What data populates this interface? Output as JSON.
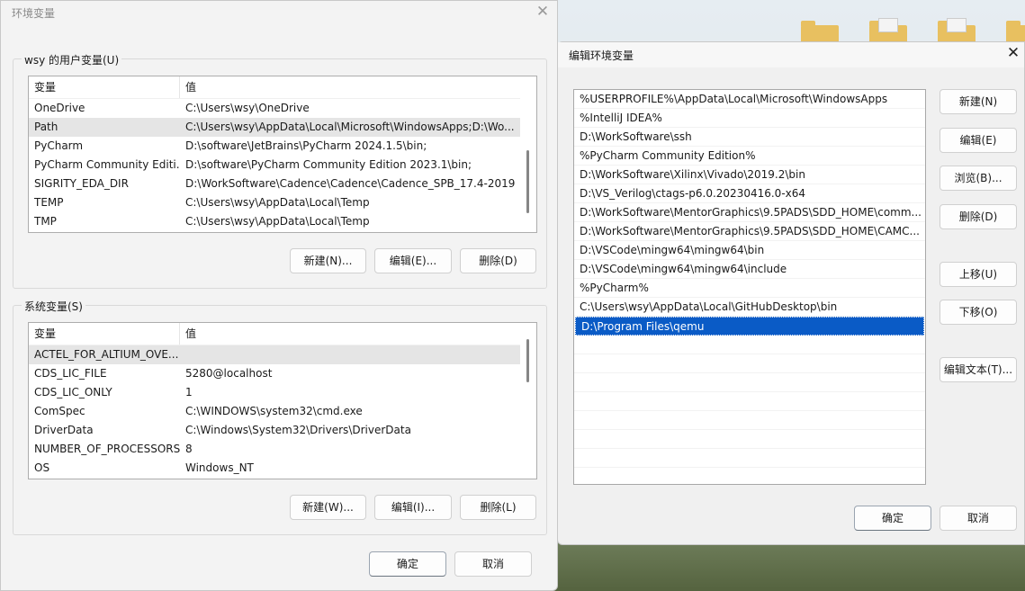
{
  "main_window": {
    "title": "环境变量",
    "user_vars": {
      "group_label": "wsy 的用户变量(U)",
      "col_name": "变量",
      "col_value": "值",
      "rows": [
        {
          "name": "OneDrive",
          "value": "C:\\Users\\wsy\\OneDrive"
        },
        {
          "name": "Path",
          "value": "C:\\Users\\wsy\\AppData\\Local\\Microsoft\\WindowsApps;D:\\Wo..."
        },
        {
          "name": "PyCharm",
          "value": "D:\\software\\JetBrains\\PyCharm 2024.1.5\\bin;"
        },
        {
          "name": "PyCharm Community Editi...",
          "value": "D:\\software\\PyCharm Community Edition 2023.1\\bin;"
        },
        {
          "name": "SIGRITY_EDA_DIR",
          "value": "D:\\WorkSoftware\\Cadence\\Cadence\\Cadence_SPB_17.4-2019"
        },
        {
          "name": "TEMP",
          "value": "C:\\Users\\wsy\\AppData\\Local\\Temp"
        },
        {
          "name": "TMP",
          "value": "C:\\Users\\wsy\\AppData\\Local\\Temp"
        }
      ],
      "new_label": "新建(N)...",
      "edit_label": "编辑(E)...",
      "delete_label": "删除(D)"
    },
    "system_vars": {
      "group_label": "系统变量(S)",
      "col_name": "变量",
      "col_value": "值",
      "rows": [
        {
          "name": "ACTEL_FOR_ALTIUM_OVE...",
          "value": ""
        },
        {
          "name": "CDS_LIC_FILE",
          "value": "5280@localhost"
        },
        {
          "name": "CDS_LIC_ONLY",
          "value": "1"
        },
        {
          "name": "ComSpec",
          "value": "C:\\WINDOWS\\system32\\cmd.exe"
        },
        {
          "name": "DriverData",
          "value": "C:\\Windows\\System32\\Drivers\\DriverData"
        },
        {
          "name": "NUMBER_OF_PROCESSORS",
          "value": "8"
        },
        {
          "name": "OS",
          "value": "Windows_NT"
        }
      ],
      "new_label": "新建(W)...",
      "edit_label": "编辑(I)...",
      "delete_label": "删除(L)"
    },
    "ok_label": "确定",
    "cancel_label": "取消"
  },
  "edit_window": {
    "title": "编辑环境变量",
    "entries": [
      "%USERPROFILE%\\AppData\\Local\\Microsoft\\WindowsApps",
      "%IntelliJ IDEA%",
      "D:\\WorkSoftware\\ssh",
      "%PyCharm Community Edition%",
      "D:\\WorkSoftware\\Xilinx\\Vivado\\2019.2\\bin",
      "D:\\VS_Verilog\\ctags-p6.0.20230416.0-x64",
      "D:\\WorkSoftware\\MentorGraphics\\9.5PADS\\SDD_HOME\\comm...",
      "D:\\WorkSoftware\\MentorGraphics\\9.5PADS\\SDD_HOME\\CAMC...",
      "D:\\VSCode\\mingw64\\mingw64\\bin",
      "D:\\VSCode\\mingw64\\mingw64\\include",
      "%PyCharm%",
      "C:\\Users\\wsy\\AppData\\Local\\GitHubDesktop\\bin",
      "D:\\Program Files\\qemu"
    ],
    "selected_index": 12,
    "buttons": {
      "new": "新建(N)",
      "edit": "编辑(E)",
      "browse": "浏览(B)...",
      "delete": "删除(D)",
      "move_up": "上移(U)",
      "move_down": "下移(O)",
      "edit_text": "编辑文本(T)..."
    },
    "ok_label": "确定",
    "cancel_label": "取消"
  }
}
